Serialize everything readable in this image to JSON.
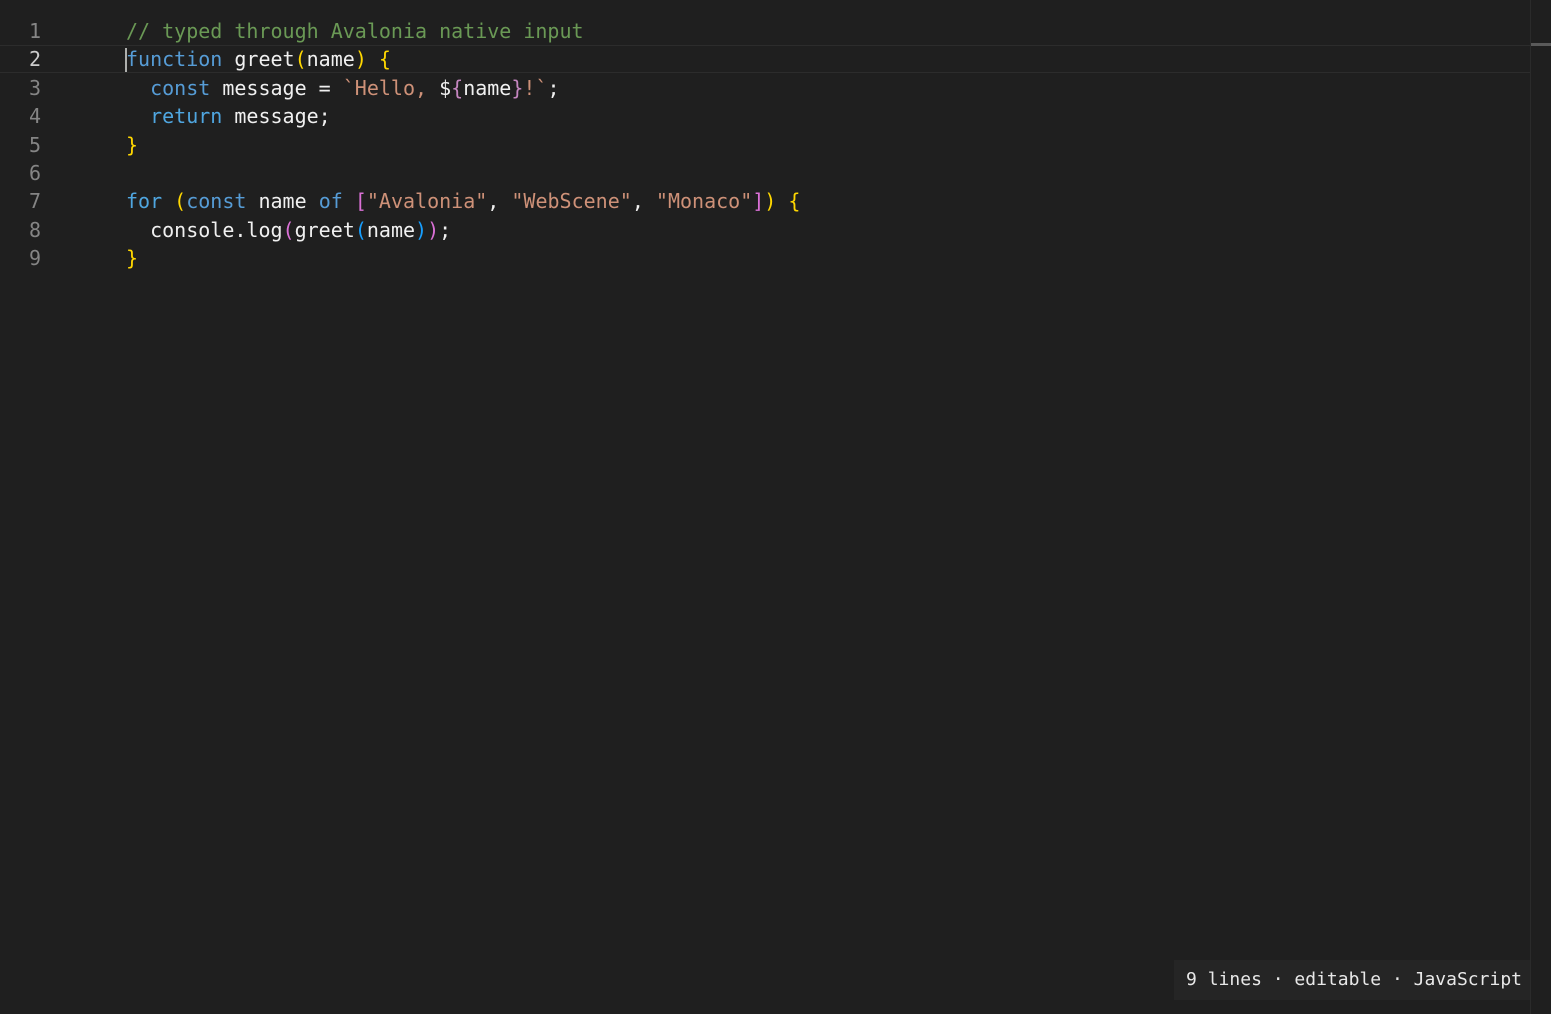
{
  "editor": {
    "language": "JavaScript",
    "lines": [
      {
        "number": "1",
        "tokens": [
          {
            "t": "// typed through Avalonia native input",
            "c": "cmt"
          }
        ]
      },
      {
        "number": "2",
        "tokens": [
          {
            "t": "function",
            "c": "kw"
          },
          {
            "t": " ",
            "c": ""
          },
          {
            "t": "greet",
            "c": "fn"
          },
          {
            "t": "(",
            "c": "b1"
          },
          {
            "t": "name",
            "c": "var"
          },
          {
            "t": ")",
            "c": "b1"
          },
          {
            "t": " ",
            "c": ""
          },
          {
            "t": "{",
            "c": "b1"
          }
        ]
      },
      {
        "number": "3",
        "tokens": [
          {
            "t": "  ",
            "c": ""
          },
          {
            "t": "const",
            "c": "kw"
          },
          {
            "t": " message = ",
            "c": "var"
          },
          {
            "t": "`Hello, ",
            "c": "str"
          },
          {
            "t": "$",
            "c": "var"
          },
          {
            "t": "{",
            "c": "tmpl"
          },
          {
            "t": "name",
            "c": "var"
          },
          {
            "t": "}",
            "c": "tmpl"
          },
          {
            "t": "!`",
            "c": "str"
          },
          {
            "t": ";",
            "c": "var"
          }
        ]
      },
      {
        "number": "4",
        "tokens": [
          {
            "t": "  ",
            "c": ""
          },
          {
            "t": "return",
            "c": "ctl"
          },
          {
            "t": " message;",
            "c": "var"
          }
        ]
      },
      {
        "number": "5",
        "tokens": [
          {
            "t": "}",
            "c": "b1"
          }
        ]
      },
      {
        "number": "6",
        "tokens": []
      },
      {
        "number": "7",
        "tokens": [
          {
            "t": "for",
            "c": "ctl"
          },
          {
            "t": " ",
            "c": ""
          },
          {
            "t": "(",
            "c": "b1"
          },
          {
            "t": "const",
            "c": "kw"
          },
          {
            "t": " name ",
            "c": "var"
          },
          {
            "t": "of",
            "c": "kw"
          },
          {
            "t": " ",
            "c": ""
          },
          {
            "t": "[",
            "c": "b2"
          },
          {
            "t": "\"Avalonia\"",
            "c": "str"
          },
          {
            "t": ", ",
            "c": "var"
          },
          {
            "t": "\"WebScene\"",
            "c": "str"
          },
          {
            "t": ", ",
            "c": "var"
          },
          {
            "t": "\"Monaco\"",
            "c": "str"
          },
          {
            "t": "]",
            "c": "b2"
          },
          {
            "t": ")",
            "c": "b1"
          },
          {
            "t": " ",
            "c": ""
          },
          {
            "t": "{",
            "c": "b1"
          }
        ]
      },
      {
        "number": "8",
        "tokens": [
          {
            "t": "  console.",
            "c": "var"
          },
          {
            "t": "log",
            "c": "fn"
          },
          {
            "t": "(",
            "c": "b2"
          },
          {
            "t": "greet",
            "c": "fn"
          },
          {
            "t": "(",
            "c": "b3"
          },
          {
            "t": "name",
            "c": "var"
          },
          {
            "t": ")",
            "c": "b3"
          },
          {
            "t": ")",
            "c": "b2"
          },
          {
            "t": ";",
            "c": "var"
          }
        ]
      },
      {
        "number": "9",
        "tokens": [
          {
            "t": "}",
            "c": "b1"
          }
        ]
      }
    ],
    "active_line": "2"
  },
  "status_bar": {
    "text": "9 lines · editable · JavaScript"
  }
}
